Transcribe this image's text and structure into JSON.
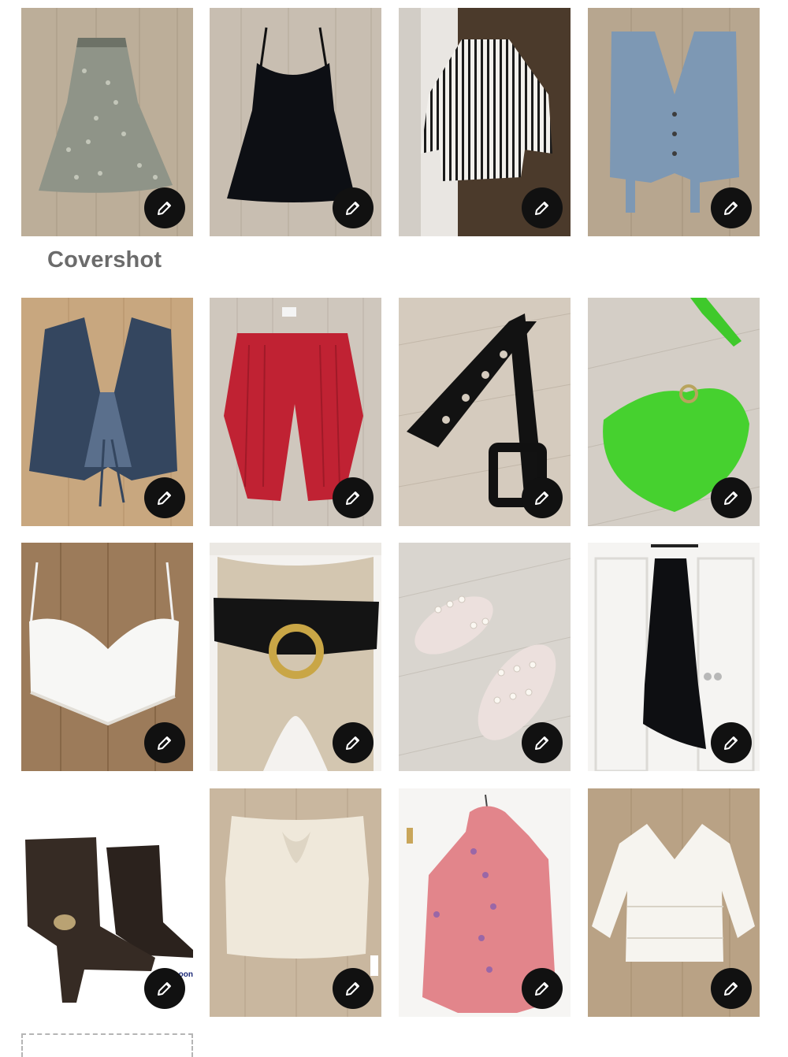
{
  "section": {
    "title": "Covershot"
  },
  "listings": [
    {
      "item": "floral-midi-skirt",
      "edit_icon": "pencil-icon"
    },
    {
      "item": "black-lace-slip-dress",
      "edit_icon": "pencil-icon"
    },
    {
      "item": "striped-button-shirt",
      "edit_icon": "pencil-icon"
    },
    {
      "item": "denim-vest",
      "edit_icon": "pencil-icon"
    },
    {
      "item": "denim-tie-front-vest",
      "edit_icon": "pencil-icon"
    },
    {
      "item": "red-knit-pants",
      "edit_icon": "pencil-icon"
    },
    {
      "item": "black-patent-belt",
      "edit_icon": "pencil-icon"
    },
    {
      "item": "green-crochet-halter-top",
      "edit_icon": "pencil-icon"
    },
    {
      "item": "white-lace-cami",
      "edit_icon": "pencil-icon"
    },
    {
      "item": "black-ring-belt",
      "edit_icon": "pencil-icon"
    },
    {
      "item": "pearl-jelly-sandals",
      "edit_icon": "pencil-icon"
    },
    {
      "item": "black-slip-dress",
      "edit_icon": "pencil-icon"
    },
    {
      "item": "brown-suede-boots",
      "edit_icon": "pencil-icon",
      "brand_tag": "Da.oon"
    },
    {
      "item": "cream-twist-tube-top",
      "edit_icon": "pencil-icon"
    },
    {
      "item": "pink-knit-poncho",
      "edit_icon": "pencil-icon"
    },
    {
      "item": "white-crochet-tunic",
      "edit_icon": "pencil-icon"
    }
  ],
  "colors": {
    "edit_button": "#111111",
    "section_title": "#6b6b6b",
    "floor": "#b9ab98"
  }
}
